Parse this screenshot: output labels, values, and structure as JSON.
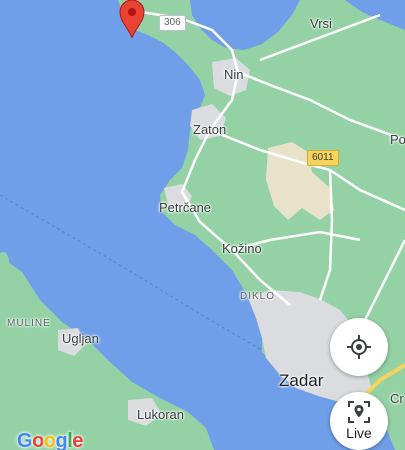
{
  "colors": {
    "sea": "#6f9fe8",
    "land": "#94d2a5",
    "urban": "#dadce0",
    "sand": "#e8e2c8",
    "pin": "#ea4335"
  },
  "places": {
    "vrsi": "Vrsi",
    "nin": "Nin",
    "zaton": "Zaton",
    "po": "Po",
    "petrcane": "Petrčane",
    "kozino": "Kožino",
    "diklo": "DIKLO",
    "muline": "MULINE",
    "ugljan": "Ugljan",
    "zadar": "Zadar",
    "lukoran": "Lukoran",
    "cr": "Cr"
  },
  "roads": {
    "shield_306": "306",
    "shield_6011": "6011"
  },
  "controls": {
    "my_location_icon": "crosshair-icon",
    "live_icon": "live-view-icon",
    "live_label": "Live"
  },
  "brand": {
    "logo_letters": [
      "G",
      "o",
      "o",
      "g",
      "l",
      "e"
    ]
  },
  "marker": {
    "icon": "map-pin-icon"
  }
}
